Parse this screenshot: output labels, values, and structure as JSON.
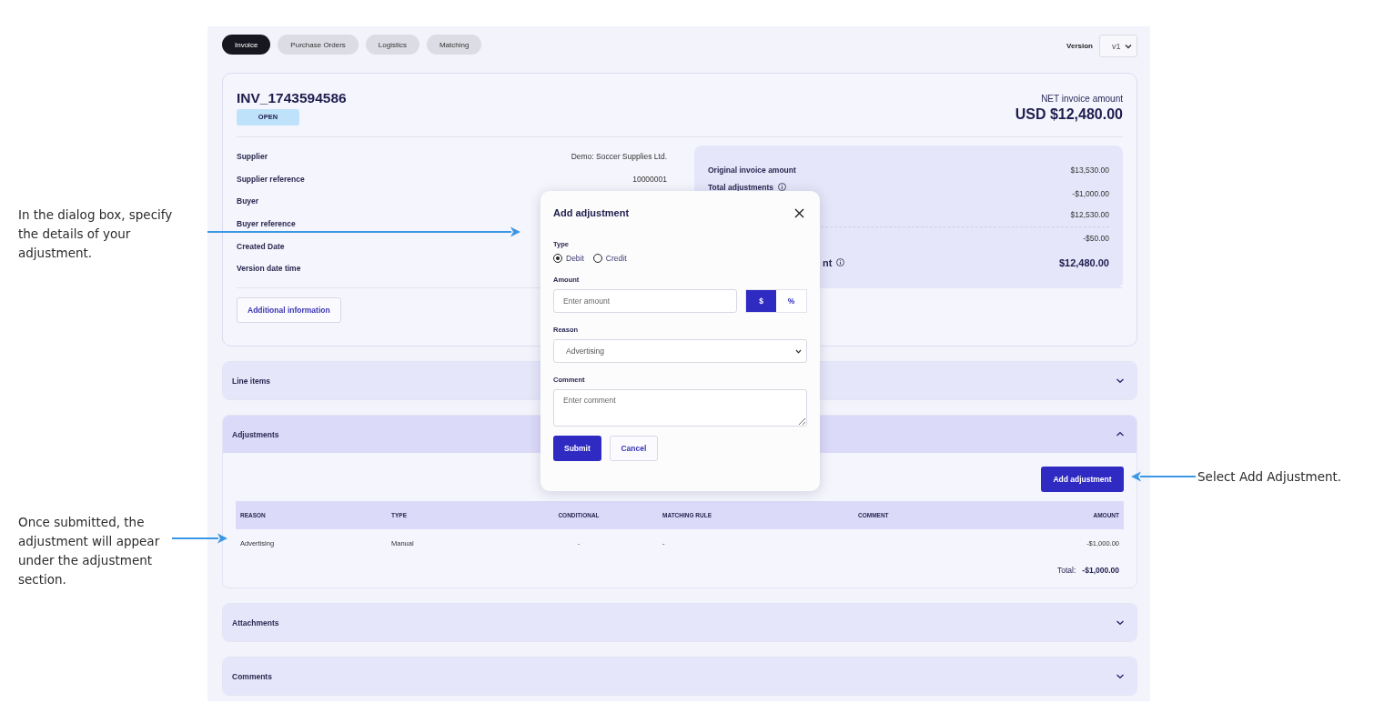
{
  "annotations": [
    {
      "text": "In the dialog box, specify the details of your adjustment.",
      "kind": "left-top"
    },
    {
      "text": "Once submitted, the adjustment will appear under the adjustment section.",
      "kind": "left-bottom"
    },
    {
      "text": "Select Add Adjustment.",
      "kind": "right"
    }
  ],
  "tabs": [
    {
      "label": "Invoice",
      "selected": true
    },
    {
      "label": "Purchase Orders",
      "selected": false
    },
    {
      "label": "Logistics",
      "selected": false
    },
    {
      "label": "Matching",
      "selected": false
    }
  ],
  "version": {
    "label": "Version",
    "value": "v1"
  },
  "invoice": {
    "number": "INV_1743594586",
    "status": "OPEN",
    "net_label": "NET invoice amount",
    "net_amount": "USD $12,480.00",
    "details": [
      {
        "label": "Supplier",
        "value": "Demo: Soccer Supplies Ltd."
      },
      {
        "label": "Supplier reference",
        "value": "10000001"
      },
      {
        "label": "Buyer"
      },
      {
        "label": "Buyer reference"
      },
      {
        "label": "Created Date"
      },
      {
        "label": "Version date time"
      }
    ],
    "summary": [
      {
        "kind": "plain",
        "label": "Original invoice amount",
        "value": "$13,530.00"
      },
      {
        "kind": "plain",
        "label": "Total adjustments",
        "value": "-$1,000.00",
        "info": true
      },
      {
        "kind": "subtotal",
        "value": "$12,530.00"
      },
      {
        "kind": "plain",
        "value": "-$50.00"
      },
      {
        "kind": "total",
        "label": "nt",
        "value": "$12,480.00",
        "info": true,
        "clipped": true
      }
    ],
    "more_button": "Additional information"
  },
  "sections": [
    {
      "kind": "plain",
      "title": "Line items",
      "expanded": false
    },
    {
      "kind": "adjustments",
      "title": "Adjustments",
      "expanded": true
    },
    {
      "kind": "plain",
      "title": "Attachments",
      "expanded": false
    },
    {
      "kind": "plain",
      "title": "Comments",
      "expanded": false
    }
  ],
  "adjustments": {
    "add_button": "Add adjustment",
    "columns": [
      "REASON",
      "TYPE",
      "CONDITIONAL",
      "MATCHING RULE",
      "COMMENT",
      "AMOUNT"
    ],
    "rows": [
      [
        "Advertising",
        "Manual",
        "-",
        "-",
        "",
        "-$1,000.00"
      ]
    ],
    "total_label": "Total:",
    "total_value": "-$1,000.00"
  },
  "dialog": {
    "title": "Add adjustment",
    "type_label": "Type",
    "types": [
      {
        "label": "Debit",
        "selected": true
      },
      {
        "label": "Credit",
        "selected": false
      }
    ],
    "amount_label": "Amount",
    "amount_placeholder": "Enter amount",
    "units": [
      {
        "label": "$",
        "selected": true
      },
      {
        "label": "%",
        "selected": false
      }
    ],
    "reason_label": "Reason",
    "reason_value": "Advertising",
    "comment_label": "Comment",
    "comment_placeholder": "Enter comment",
    "submit": "Submit",
    "cancel": "Cancel"
  }
}
